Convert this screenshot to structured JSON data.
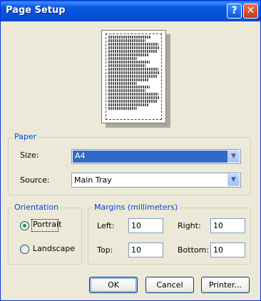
{
  "window": {
    "title": "Page Setup"
  },
  "titlebar": {
    "help_label": "?",
    "close_label": "✕"
  },
  "paper": {
    "legend": "Paper",
    "size_label": "Size:",
    "size_value": "A4",
    "source_label": "Source:",
    "source_value": "Main Tray"
  },
  "orientation": {
    "legend": "Orientation",
    "portrait_label": "Portrait",
    "landscape_label": "Landscape",
    "selected": "Portrait"
  },
  "margins": {
    "legend": "Margins (millimeters)",
    "left_label": "Left:",
    "left_value": "10",
    "right_label": "Right:",
    "right_value": "10",
    "top_label": "Top:",
    "top_value": "10",
    "bottom_label": "Bottom:",
    "bottom_value": "10"
  },
  "buttons": {
    "ok": "OK",
    "cancel": "Cancel",
    "printer": "Printer..."
  },
  "icons": {
    "help": "help-icon",
    "close": "close-icon",
    "dropdown": "chevron-down-icon"
  },
  "colors": {
    "titlebar": "#0a58e0",
    "accent_legend": "#0046d5",
    "selection": "#316ac5",
    "radio_dot": "#21a121"
  }
}
